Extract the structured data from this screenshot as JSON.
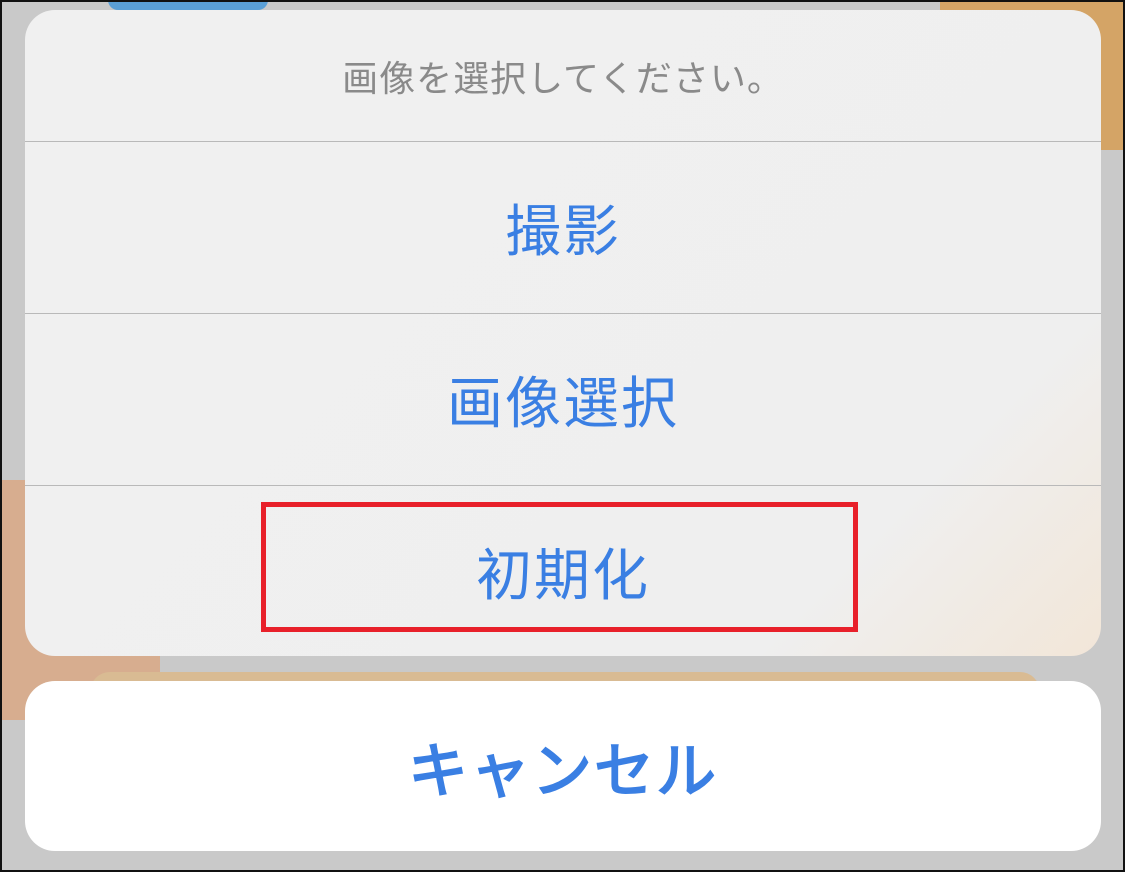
{
  "action_sheet": {
    "title": "画像を選択してください。",
    "options": [
      {
        "label": "撮影"
      },
      {
        "label": "画像選択"
      },
      {
        "label": "初期化"
      }
    ]
  },
  "cancel_label": "キャンセル",
  "colors": {
    "accent": "#3a7fe3",
    "title_text": "#8a8a8a",
    "highlight_border": "#e8202a",
    "sheet_bg": "#efefef",
    "cancel_bg": "#ffffff"
  }
}
